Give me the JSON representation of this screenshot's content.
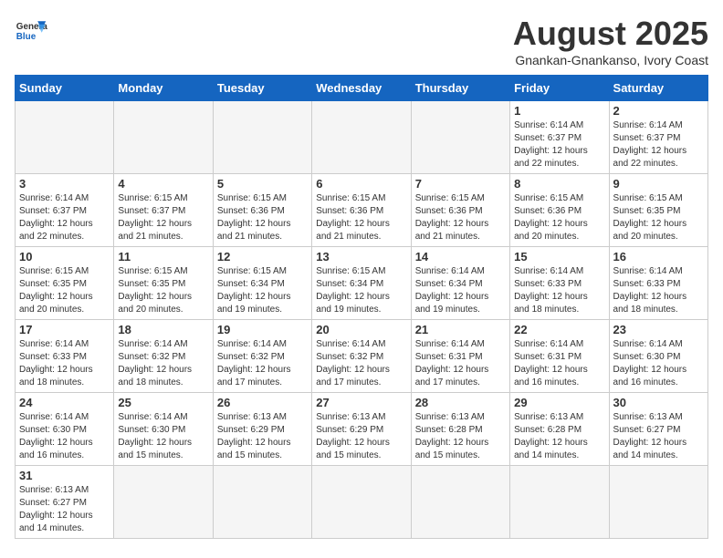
{
  "header": {
    "logo_general": "General",
    "logo_blue": "Blue",
    "title": "August 2025",
    "subtitle": "Gnankan-Gnankanso, Ivory Coast"
  },
  "weekdays": [
    "Sunday",
    "Monday",
    "Tuesday",
    "Wednesday",
    "Thursday",
    "Friday",
    "Saturday"
  ],
  "weeks": [
    [
      {
        "day": "",
        "info": "",
        "empty": true
      },
      {
        "day": "",
        "info": "",
        "empty": true
      },
      {
        "day": "",
        "info": "",
        "empty": true
      },
      {
        "day": "",
        "info": "",
        "empty": true
      },
      {
        "day": "",
        "info": "",
        "empty": true
      },
      {
        "day": "1",
        "info": "Sunrise: 6:14 AM\nSunset: 6:37 PM\nDaylight: 12 hours and 22 minutes.",
        "empty": false
      },
      {
        "day": "2",
        "info": "Sunrise: 6:14 AM\nSunset: 6:37 PM\nDaylight: 12 hours and 22 minutes.",
        "empty": false
      }
    ],
    [
      {
        "day": "3",
        "info": "Sunrise: 6:14 AM\nSunset: 6:37 PM\nDaylight: 12 hours and 22 minutes.",
        "empty": false
      },
      {
        "day": "4",
        "info": "Sunrise: 6:15 AM\nSunset: 6:37 PM\nDaylight: 12 hours and 21 minutes.",
        "empty": false
      },
      {
        "day": "5",
        "info": "Sunrise: 6:15 AM\nSunset: 6:36 PM\nDaylight: 12 hours and 21 minutes.",
        "empty": false
      },
      {
        "day": "6",
        "info": "Sunrise: 6:15 AM\nSunset: 6:36 PM\nDaylight: 12 hours and 21 minutes.",
        "empty": false
      },
      {
        "day": "7",
        "info": "Sunrise: 6:15 AM\nSunset: 6:36 PM\nDaylight: 12 hours and 21 minutes.",
        "empty": false
      },
      {
        "day": "8",
        "info": "Sunrise: 6:15 AM\nSunset: 6:36 PM\nDaylight: 12 hours and 20 minutes.",
        "empty": false
      },
      {
        "day": "9",
        "info": "Sunrise: 6:15 AM\nSunset: 6:35 PM\nDaylight: 12 hours and 20 minutes.",
        "empty": false
      }
    ],
    [
      {
        "day": "10",
        "info": "Sunrise: 6:15 AM\nSunset: 6:35 PM\nDaylight: 12 hours and 20 minutes.",
        "empty": false
      },
      {
        "day": "11",
        "info": "Sunrise: 6:15 AM\nSunset: 6:35 PM\nDaylight: 12 hours and 20 minutes.",
        "empty": false
      },
      {
        "day": "12",
        "info": "Sunrise: 6:15 AM\nSunset: 6:34 PM\nDaylight: 12 hours and 19 minutes.",
        "empty": false
      },
      {
        "day": "13",
        "info": "Sunrise: 6:15 AM\nSunset: 6:34 PM\nDaylight: 12 hours and 19 minutes.",
        "empty": false
      },
      {
        "day": "14",
        "info": "Sunrise: 6:14 AM\nSunset: 6:34 PM\nDaylight: 12 hours and 19 minutes.",
        "empty": false
      },
      {
        "day": "15",
        "info": "Sunrise: 6:14 AM\nSunset: 6:33 PM\nDaylight: 12 hours and 18 minutes.",
        "empty": false
      },
      {
        "day": "16",
        "info": "Sunrise: 6:14 AM\nSunset: 6:33 PM\nDaylight: 12 hours and 18 minutes.",
        "empty": false
      }
    ],
    [
      {
        "day": "17",
        "info": "Sunrise: 6:14 AM\nSunset: 6:33 PM\nDaylight: 12 hours and 18 minutes.",
        "empty": false
      },
      {
        "day": "18",
        "info": "Sunrise: 6:14 AM\nSunset: 6:32 PM\nDaylight: 12 hours and 18 minutes.",
        "empty": false
      },
      {
        "day": "19",
        "info": "Sunrise: 6:14 AM\nSunset: 6:32 PM\nDaylight: 12 hours and 17 minutes.",
        "empty": false
      },
      {
        "day": "20",
        "info": "Sunrise: 6:14 AM\nSunset: 6:32 PM\nDaylight: 12 hours and 17 minutes.",
        "empty": false
      },
      {
        "day": "21",
        "info": "Sunrise: 6:14 AM\nSunset: 6:31 PM\nDaylight: 12 hours and 17 minutes.",
        "empty": false
      },
      {
        "day": "22",
        "info": "Sunrise: 6:14 AM\nSunset: 6:31 PM\nDaylight: 12 hours and 16 minutes.",
        "empty": false
      },
      {
        "day": "23",
        "info": "Sunrise: 6:14 AM\nSunset: 6:30 PM\nDaylight: 12 hours and 16 minutes.",
        "empty": false
      }
    ],
    [
      {
        "day": "24",
        "info": "Sunrise: 6:14 AM\nSunset: 6:30 PM\nDaylight: 12 hours and 16 minutes.",
        "empty": false
      },
      {
        "day": "25",
        "info": "Sunrise: 6:14 AM\nSunset: 6:30 PM\nDaylight: 12 hours and 15 minutes.",
        "empty": false
      },
      {
        "day": "26",
        "info": "Sunrise: 6:13 AM\nSunset: 6:29 PM\nDaylight: 12 hours and 15 minutes.",
        "empty": false
      },
      {
        "day": "27",
        "info": "Sunrise: 6:13 AM\nSunset: 6:29 PM\nDaylight: 12 hours and 15 minutes.",
        "empty": false
      },
      {
        "day": "28",
        "info": "Sunrise: 6:13 AM\nSunset: 6:28 PM\nDaylight: 12 hours and 15 minutes.",
        "empty": false
      },
      {
        "day": "29",
        "info": "Sunrise: 6:13 AM\nSunset: 6:28 PM\nDaylight: 12 hours and 14 minutes.",
        "empty": false
      },
      {
        "day": "30",
        "info": "Sunrise: 6:13 AM\nSunset: 6:27 PM\nDaylight: 12 hours and 14 minutes.",
        "empty": false
      }
    ],
    [
      {
        "day": "31",
        "info": "Sunrise: 6:13 AM\nSunset: 6:27 PM\nDaylight: 12 hours and 14 minutes.",
        "empty": false
      },
      {
        "day": "",
        "info": "",
        "empty": true
      },
      {
        "day": "",
        "info": "",
        "empty": true
      },
      {
        "day": "",
        "info": "",
        "empty": true
      },
      {
        "day": "",
        "info": "",
        "empty": true
      },
      {
        "day": "",
        "info": "",
        "empty": true
      },
      {
        "day": "",
        "info": "",
        "empty": true
      }
    ]
  ]
}
